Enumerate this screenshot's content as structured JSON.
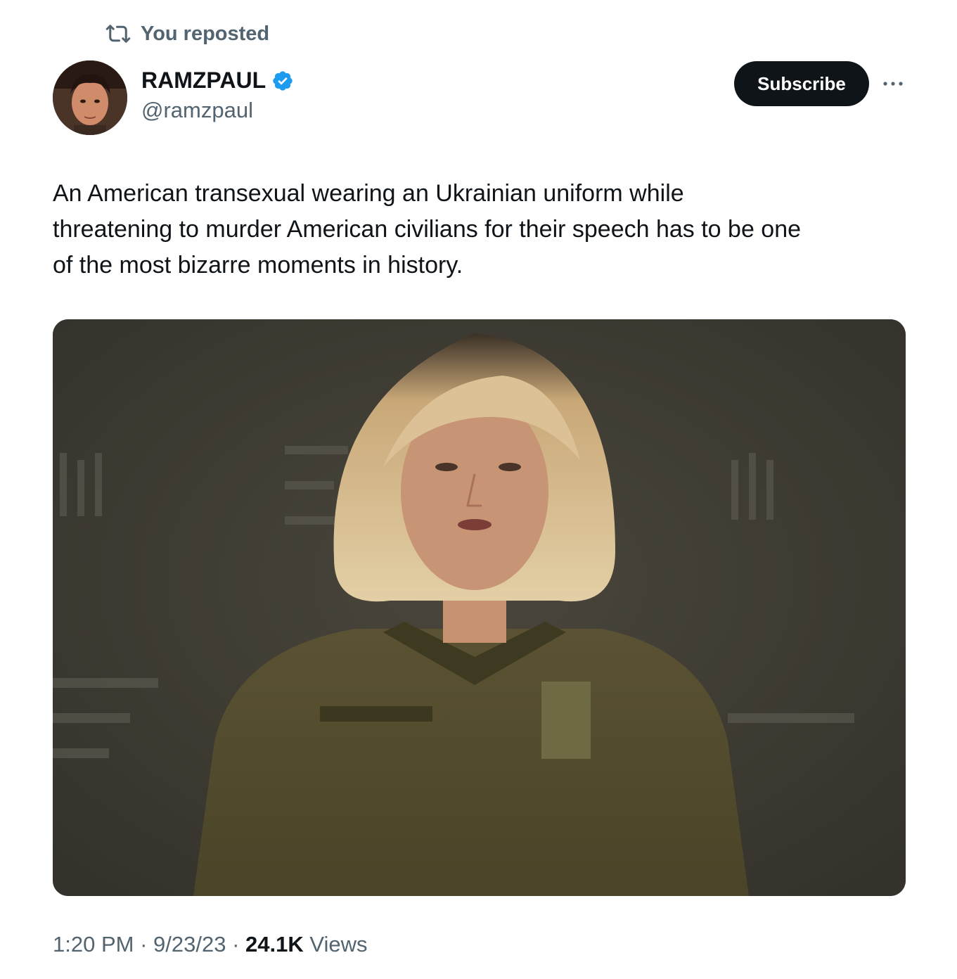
{
  "repost": {
    "label": "You reposted",
    "icon": "repost-icon"
  },
  "author": {
    "display_name": "RAMZPAUL",
    "handle": "@ramzpaul",
    "verified_icon": "verified-badge-icon",
    "avatar_icon": "avatar-photo"
  },
  "actions": {
    "subscribe_label": "Subscribe",
    "more_icon": "more-options-icon"
  },
  "tweet": {
    "text": "An American transexual wearing an Ukrainian uniform while\nthreatening to murder American civilians for their speech has to be one\nof the most bizarre moments in history.",
    "media_icon": "embedded-photo"
  },
  "meta": {
    "time": "1:20 PM",
    "separator": " · ",
    "date": "9/23/23",
    "views_count": "24.1K",
    "views_label": " Views"
  },
  "colors": {
    "text": "#0f1419",
    "secondary": "#536471",
    "verified": "#1d9bf0",
    "button_bg": "#0f1419"
  }
}
